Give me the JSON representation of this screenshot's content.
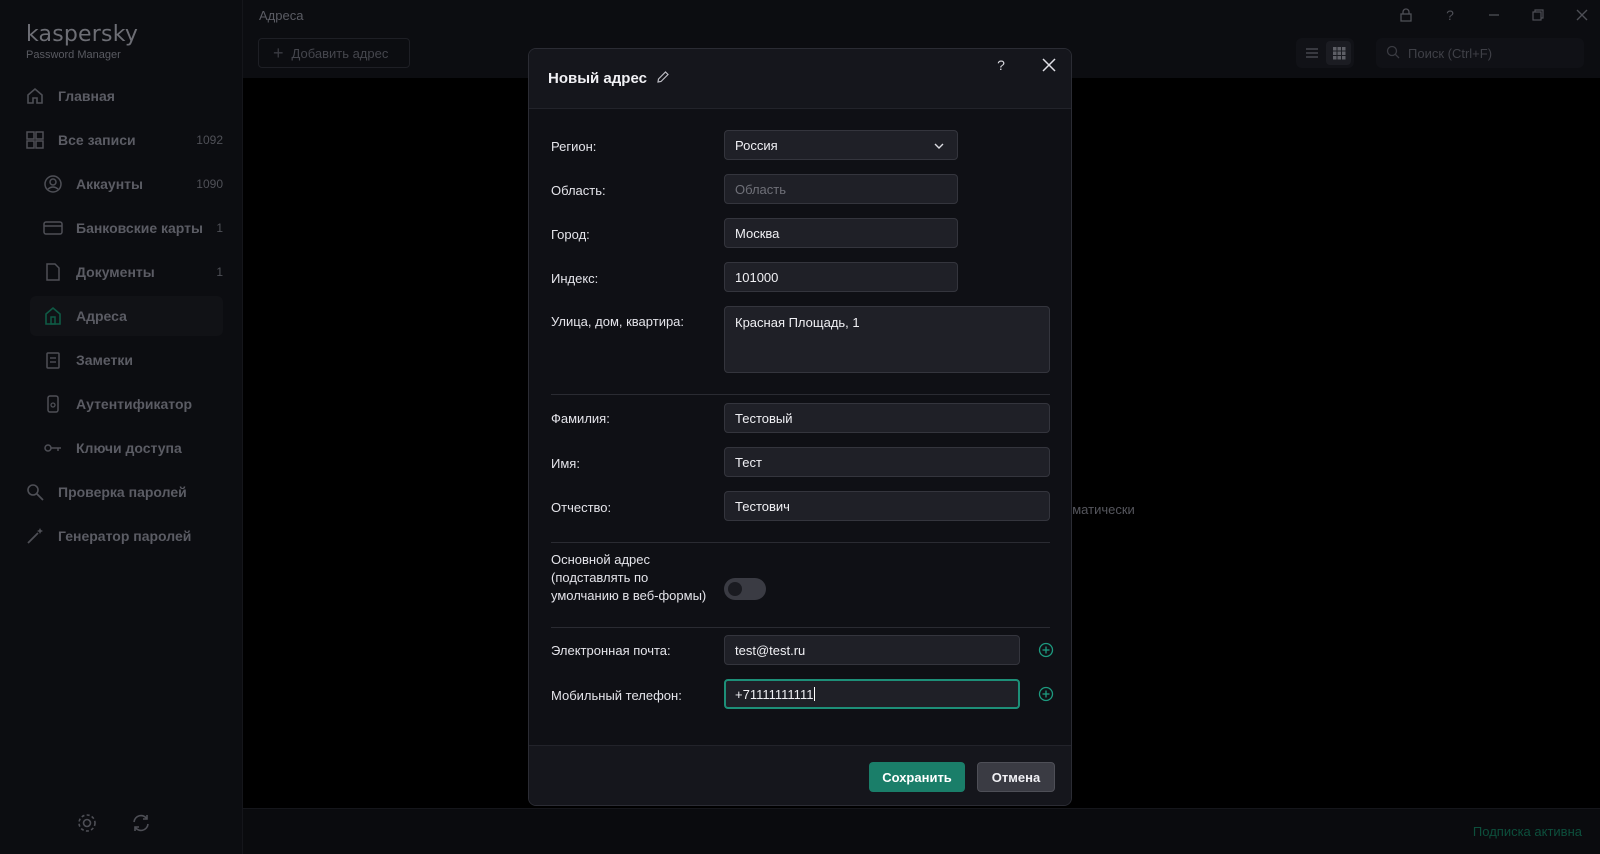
{
  "app": {
    "logo": "kaspersky",
    "logo_sub": "Password Manager",
    "page_title": "Адреса",
    "add_button": "Добавить адрес",
    "search_placeholder": "Поиск (Ctrl+F)",
    "background_hint": "оматически",
    "subscription_status": "Подписка активна"
  },
  "sidebar": {
    "items": [
      {
        "label": "Главная",
        "count": "",
        "icon": "home-icon"
      },
      {
        "label": "Все записи",
        "count": "1092",
        "icon": "grid-icon"
      },
      {
        "label": "Аккаунты",
        "count": "1090",
        "icon": "user-icon"
      },
      {
        "label": "Банковские карты",
        "count": "1",
        "icon": "card-icon"
      },
      {
        "label": "Документы",
        "count": "1",
        "icon": "document-icon"
      },
      {
        "label": "Адреса",
        "count": "",
        "icon": "address-icon"
      },
      {
        "label": "Заметки",
        "count": "",
        "icon": "notes-icon"
      },
      {
        "label": "Аутентификатор",
        "count": "",
        "icon": "authenticator-icon"
      },
      {
        "label": "Ключи доступа",
        "count": "",
        "icon": "key-icon"
      },
      {
        "label": "Проверка паролей",
        "count": "",
        "icon": "password-check-icon"
      },
      {
        "label": "Генератор паролей",
        "count": "",
        "icon": "magic-wand-icon"
      }
    ]
  },
  "dialog": {
    "title": "Новый адрес",
    "help": "?",
    "fields": {
      "region": {
        "label": "Регион:",
        "value": "Россия"
      },
      "area": {
        "label": "Область:",
        "value": "",
        "placeholder": "Область"
      },
      "city": {
        "label": "Город:",
        "value": "Москва"
      },
      "index": {
        "label": "Индекс:",
        "value": "101000"
      },
      "street": {
        "label": "Улица, дом, квартира:",
        "value": "Красная Площадь, 1"
      },
      "last_name": {
        "label": "Фамилия:",
        "value": "Тестовый"
      },
      "first_name": {
        "label": "Имя:",
        "value": "Тест"
      },
      "patronymic": {
        "label": "Отчество:",
        "value": "Тестович"
      },
      "default_address": {
        "label_lines": [
          "Основной адрес",
          "(подставлять по",
          "умолчанию в веб-формы)"
        ],
        "enabled": false
      },
      "email": {
        "label": "Электронная почта:",
        "value": "test@test.ru"
      },
      "phone": {
        "label": "Мобильный телефон:",
        "value": "+71111111111"
      }
    },
    "save": "Сохранить",
    "cancel": "Отмена"
  },
  "colors": {
    "accent": "#1a7e69",
    "focus": "#1d8f78",
    "dialog_bg": "#0f1015",
    "field_bg": "#1f2027"
  }
}
